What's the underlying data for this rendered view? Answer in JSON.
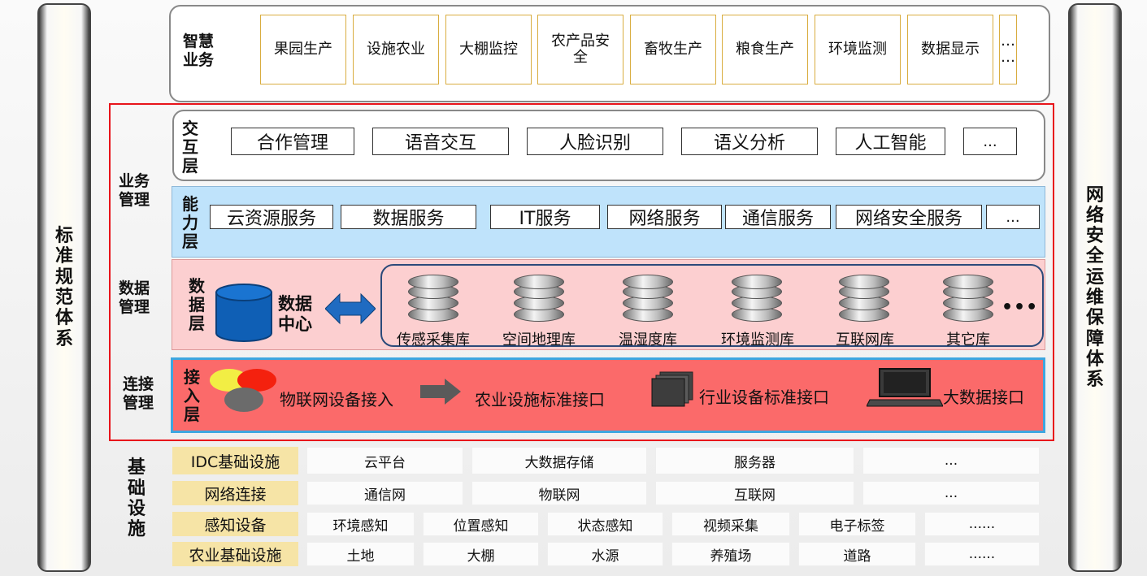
{
  "left_pillar": {
    "chars": [
      "标",
      "准",
      "规",
      "范",
      "体",
      "系"
    ]
  },
  "right_pillar": {
    "chars": [
      "网",
      "络",
      "安",
      "全",
      "运",
      "维",
      "保",
      "障",
      "体",
      "系"
    ]
  },
  "smart_business": {
    "label": [
      "智慧",
      "业务"
    ],
    "items": [
      "果园生产",
      "设施农业",
      "大棚监控",
      "农产品安全",
      "畜牧生产",
      "粮食生产",
      "环境监测",
      "数据显示"
    ],
    "more": [
      "…",
      "…"
    ]
  },
  "section_labels": {
    "business_mgmt": [
      "业务",
      "管理"
    ],
    "data_mgmt": [
      "数据",
      "管理"
    ],
    "connect_mgmt": [
      "连接",
      "管理"
    ],
    "infrastructure": [
      "基",
      "础",
      "设",
      "施"
    ]
  },
  "interaction_layer": {
    "label": [
      "交",
      "互",
      "层"
    ],
    "items": [
      "合作管理",
      "语音交互",
      "人脸识别",
      "语义分析",
      "人工智能",
      "..."
    ]
  },
  "capability_layer": {
    "label": [
      "能",
      "力",
      "层"
    ],
    "items": [
      "云资源服务",
      "数据服务",
      "IT服务",
      "网络服务",
      "通信服务",
      "网络安全服务",
      "..."
    ]
  },
  "data_layer": {
    "label": [
      "数",
      "据",
      "层"
    ],
    "center": [
      "数据",
      "中心"
    ],
    "databases": [
      "传感采集库",
      "空间地理库",
      "温湿度库",
      "环境监测库",
      "互联网库",
      "其它库"
    ],
    "more": "•••"
  },
  "access_layer": {
    "label": [
      "接",
      "入",
      "层"
    ],
    "items": [
      "物联网设备接入",
      "农业设施标准接口",
      "行业设备标准接口",
      "大数据接口"
    ]
  },
  "infrastructure_rows": [
    {
      "label": "IDC基础设施",
      "cells": [
        "云平台",
        "大数据存储",
        "服务器",
        "..."
      ]
    },
    {
      "label": "网络连接",
      "cells": [
        "通信网",
        "物联网",
        "互联网",
        "..."
      ]
    },
    {
      "label": "感知设备",
      "cells": [
        "环境感知",
        "位置感知",
        "状态感知",
        "视频采集",
        "电子标签",
        "......"
      ]
    },
    {
      "label": "农业基础设施",
      "cells": [
        "土地",
        "大棚",
        "水源",
        "养殖场",
        "道路",
        "......"
      ]
    }
  ],
  "colors": {
    "red_frame": "#e8141b",
    "capability_bg": "#bfe3fb",
    "data_bg": "#fccfd0",
    "access_bg": "#fb6a6a",
    "access_border": "#3ea6e0",
    "infra_label_bg": "#f6e4a6",
    "gold_border": "#d9ad40",
    "db_center_blue": "#0f5fb5"
  }
}
